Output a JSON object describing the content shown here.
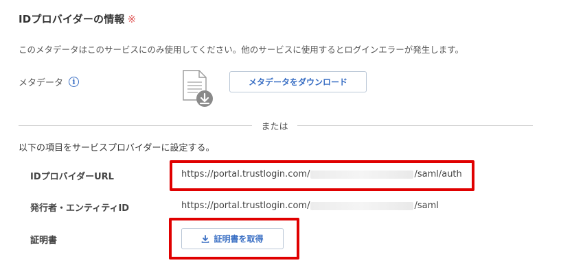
{
  "section": {
    "title": "IDプロバイダーの情報",
    "required_mark": "※",
    "description": "このメタデータはこのサービスにのみ使用してください。他のサービスに使用するとログインエラーが発生します。"
  },
  "metadata": {
    "label": "メタデータ",
    "info_icon": "i",
    "download_button": "メタデータをダウンロード"
  },
  "divider": {
    "text": "または"
  },
  "instruction": "以下の項目をサービスプロバイダーに設定する。",
  "fields": {
    "idp_url": {
      "label": "IDプロバイダーURL",
      "value_prefix": "https://portal.trustlogin.com/",
      "value_suffix": "/saml/auth"
    },
    "issuer": {
      "label": "発行者・エンティティID",
      "value_prefix": "https://portal.trustlogin.com/",
      "value_suffix": "/saml"
    },
    "certificate": {
      "label": "証明書",
      "button": "証明書を取得"
    }
  },
  "colors": {
    "accent": "#3a6fc4",
    "highlight": "#e00000",
    "required": "#e05a5a"
  }
}
